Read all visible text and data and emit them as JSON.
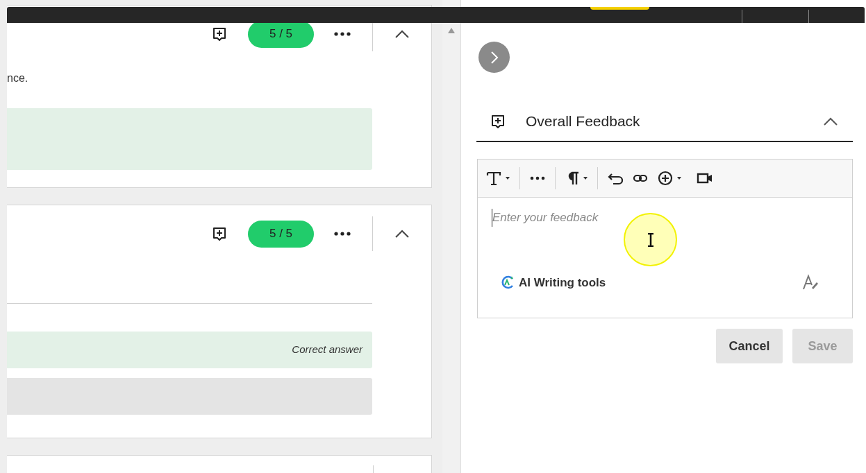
{
  "cards": [
    {
      "score": "5 / 5",
      "expanded": true,
      "items": [
        {
          "kind": "text",
          "text": "nce."
        },
        {
          "kind": "answer",
          "correct": true
        }
      ]
    },
    {
      "score": "5 / 5",
      "expanded": true,
      "items": [
        {
          "kind": "rule"
        },
        {
          "kind": "answer",
          "correct": true,
          "label": "Correct answer"
        },
        {
          "kind": "answer",
          "correct": false
        }
      ]
    }
  ],
  "feedback": {
    "title": "Overall Feedback",
    "expanded": true,
    "placeholder": "Enter your feedback",
    "ai_tools": "AI Writing tools"
  },
  "buttons": [
    {
      "label": "Cancel",
      "disabled": false
    },
    {
      "label": "Save",
      "disabled": true
    }
  ]
}
